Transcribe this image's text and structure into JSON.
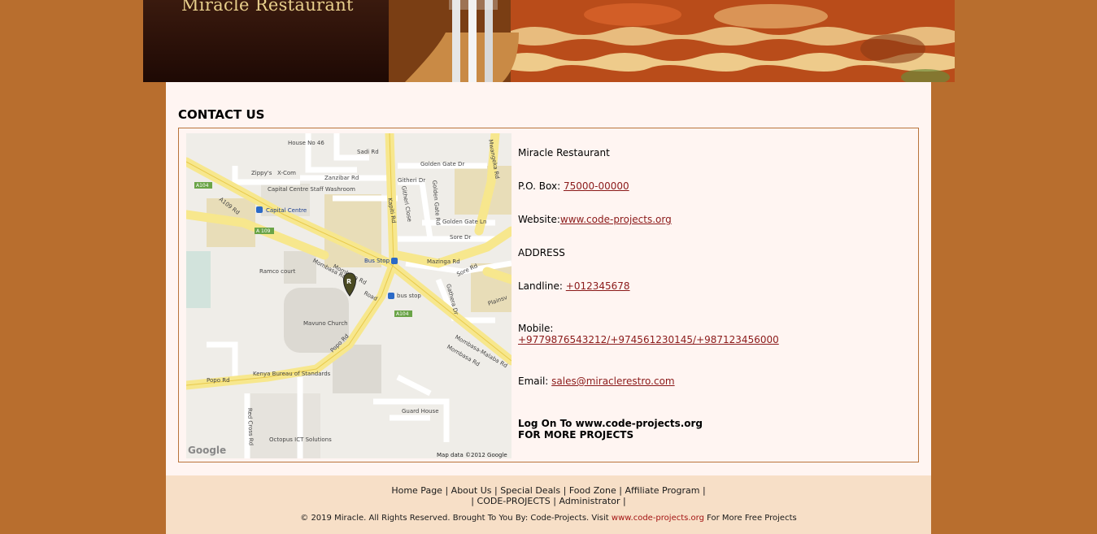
{
  "header": {
    "site_title": "Miracle Restaurant"
  },
  "page": {
    "heading": "CONTACT US"
  },
  "map": {
    "labels": {
      "house_no": "House No 46",
      "sadi_rd": "Sadi Rd",
      "golden_gate_dr": "Golden Gate Dr",
      "mwangeka_rd": "Mwangeka Rd",
      "zippys": "Zippy's",
      "x_com": "X-Com",
      "zanzibar_rd": "Zanzibar Rd",
      "githeri_dr": "Githeri Dr",
      "a104_top": "A104",
      "a109_rd": "A109 Rd",
      "capital_centre_staff": "Capital Centre Staff Washroom",
      "kapiti_rd": "Kapiti Rd",
      "golden_gate_rd": "Golden Gate Rd",
      "githeri_close": "Githeri Close",
      "capital_centre": "Capital Centre",
      "golden_gate_ln": "Golden Gate Ln",
      "a109": "A 109",
      "sore_dr": "Sore Dr",
      "bus_stop_top": "Bus Stop",
      "mazinga_rd": "Mazinga Rd",
      "sore_rd": "Sore Rd",
      "ramco_court": "Ramco court",
      "mombasa_rd_1": "Mombasa Rd",
      "mombasa_rd_2": "Mombasa Rd",
      "road": "Road",
      "bus_stop": "bus stop",
      "gathera_dr": "Gathera Dr",
      "plainsview": "Plainsv",
      "a104_mid": "A104",
      "mavuno_church": "Mavuno Church",
      "popo_rd_1": "Popo Rd",
      "mombasa_malaba_rd": "Mombasa-Malaba Rd",
      "mombasa_rd_3": "Mombasa Rd",
      "kenya_bureau": "Kenya Bureau of Standards",
      "popo_rd_2": "Popo Rd",
      "guard_house": "Guard House",
      "red_cross_rd": "Red Cross Rd",
      "octopus": "Octopus ICT Solutions",
      "google": "Google",
      "map_data": "Map data ©2012 Google",
      "marker": "R"
    }
  },
  "contact": {
    "name": "Miracle Restaurant",
    "po_box_label": "P.O. Box: ",
    "po_box_value": "75000-00000",
    "website_label": "Website:",
    "website_value": "www.code-projects.org",
    "address_label": "ADDRESS",
    "landline_label": "Landline: ",
    "landline_value": " +012345678",
    "mobile_label": "Mobile:",
    "mobile_value": "+9779876543212/+974561230145/+987123456000",
    "email_label": "Email: ",
    "email_value": "sales@miraclerestro.com",
    "promo_line1": "Log On To www.code-projects.org",
    "promo_line2": "FOR MORE PROJECTS"
  },
  "footer": {
    "nav_row1": [
      "Home Page",
      "About Us",
      "Special Deals",
      "Food Zone",
      "Affiliate Program"
    ],
    "nav_row2": [
      "CODE-PROJECTS",
      "Administrator"
    ],
    "separator": "|",
    "copyright_prefix": "© 2019 Miracle. All Rights Reserved. Brought To You By: Code-Projects. Visit ",
    "copyright_link": "www.code-projects.org",
    "copyright_suffix": " For More Free Projects"
  },
  "colors": {
    "page_bg": "#b86e2e",
    "content_bg": "#fff5f2",
    "footer_bg": "#f7dfc7",
    "link": "#8b1a1a",
    "border": "#b8743c"
  }
}
